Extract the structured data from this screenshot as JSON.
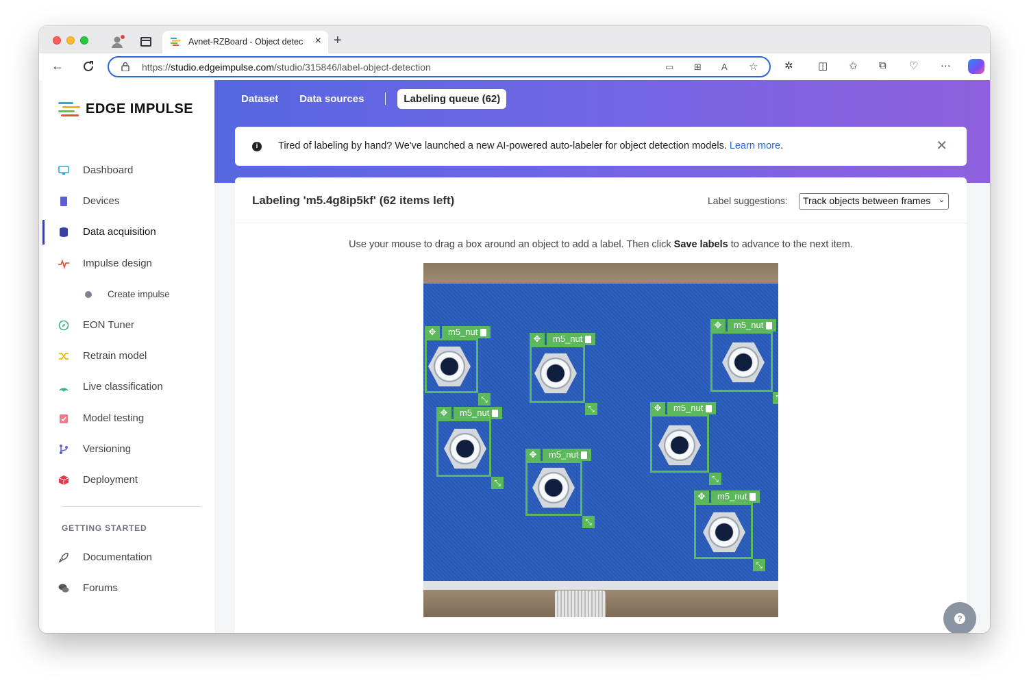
{
  "browser": {
    "tab_title": "Avnet-RZBoard - Object detec",
    "url_prefix": "https://",
    "url_host": "studio.edgeimpulse.com",
    "url_path": "/studio/315846/label-object-detection"
  },
  "brand": {
    "name": "EDGE IMPULSE"
  },
  "sidebar": {
    "items": [
      {
        "label": "Dashboard",
        "icon": "monitor-icon"
      },
      {
        "label": "Devices",
        "icon": "chip-icon"
      },
      {
        "label": "Data acquisition",
        "icon": "database-icon"
      },
      {
        "label": "Impulse design",
        "icon": "pulse-icon"
      },
      {
        "label": "Create impulse",
        "icon": "dot-icon"
      },
      {
        "label": "EON Tuner",
        "icon": "compass-icon"
      },
      {
        "label": "Retrain model",
        "icon": "shuffle-icon"
      },
      {
        "label": "Live classification",
        "icon": "signal-icon"
      },
      {
        "label": "Model testing",
        "icon": "clipboard-check-icon"
      },
      {
        "label": "Versioning",
        "icon": "branch-icon"
      },
      {
        "label": "Deployment",
        "icon": "box-icon"
      }
    ],
    "section_title": "GETTING STARTED",
    "getting_started": [
      {
        "label": "Documentation",
        "icon": "rocket-icon"
      },
      {
        "label": "Forums",
        "icon": "chat-icon"
      }
    ]
  },
  "subnav": {
    "dataset": "Dataset",
    "data_sources": "Data sources",
    "labeling_queue": "Labeling queue (62)"
  },
  "notice": {
    "text": "Tired of labeling by hand? We've launched a new AI-powered auto-labeler for object detection models.",
    "link": "Learn more",
    "suffix": "."
  },
  "labeling": {
    "title": "Labeling 'm5.4g8ip5kf' (62 items left)",
    "suggestions_label": "Label suggestions:",
    "suggestions_value": "Track objects between frames",
    "instruction_pre": "Use your mouse to drag a box around an object to add a label. Then click",
    "instruction_bold": "Save labels",
    "instruction_post": "to advance to the next item."
  },
  "boxes": [
    {
      "label": "m5_nut"
    },
    {
      "label": "m5_nut"
    },
    {
      "label": "m5_nut"
    },
    {
      "label": "m5_nut"
    },
    {
      "label": "m5_nut"
    },
    {
      "label": "m5_nut"
    },
    {
      "label": "m5_nut"
    },
    {
      "label": "m5_nut"
    }
  ],
  "colors": {
    "accent": "#5667e0",
    "box": "#5cb85c",
    "link": "#2b67d9"
  }
}
